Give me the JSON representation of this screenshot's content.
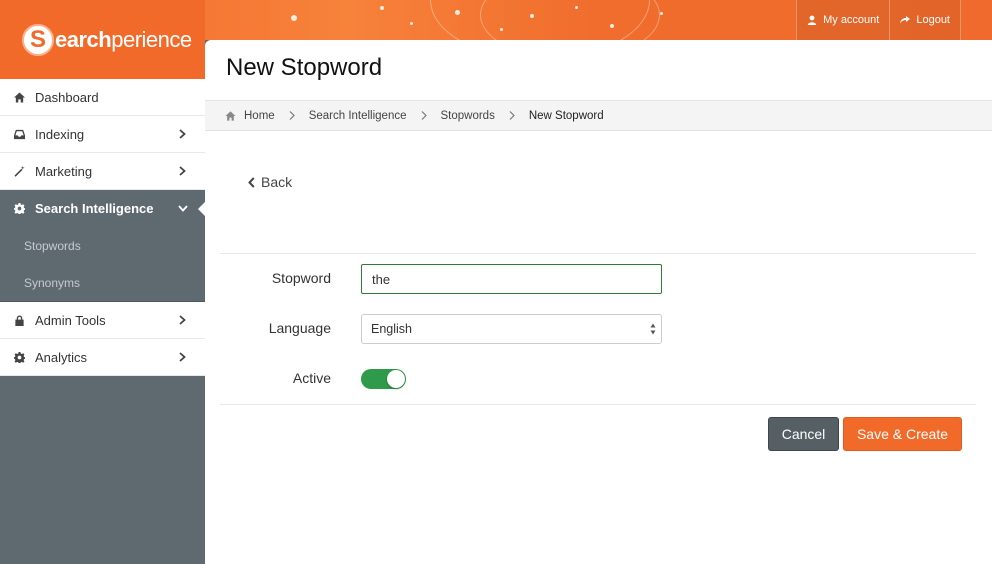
{
  "header": {
    "logo_prefix": "S",
    "logo_text_bold": "earch",
    "logo_text_rest": "perience",
    "links": [
      {
        "label": "My account",
        "icon": "user-icon"
      },
      {
        "label": "Logout",
        "icon": "logout-icon"
      }
    ]
  },
  "sidebar": {
    "items": [
      {
        "label": "Dashboard",
        "icon": "home-icon",
        "has_children": false
      },
      {
        "label": "Indexing",
        "icon": "inbox-icon",
        "has_children": true
      },
      {
        "label": "Marketing",
        "icon": "wand-icon",
        "has_children": true
      },
      {
        "label": "Search Intelligence",
        "icon": "gear-icon",
        "has_children": true,
        "active": true
      },
      {
        "label": "Admin Tools",
        "icon": "lock-icon",
        "has_children": true
      },
      {
        "label": "Analytics",
        "icon": "gear-icon",
        "has_children": true
      }
    ],
    "sub_items": [
      {
        "label": "Stopwords"
      },
      {
        "label": "Synonyms"
      }
    ]
  },
  "page": {
    "title": "New Stopword",
    "breadcrumb": [
      "Home",
      "Search Intelligence",
      "Stopwords",
      "New Stopword"
    ],
    "back_label": "Back"
  },
  "form": {
    "stopword_label": "Stopword",
    "stopword_value": "the",
    "language_label": "Language",
    "language_value": "English",
    "active_label": "Active",
    "active_on": true,
    "cancel_label": "Cancel",
    "save_label": "Save & Create"
  },
  "colors": {
    "accent": "#f26a2a",
    "sidebar_dark": "#5f6a70",
    "toggle_on": "#2f9b4a",
    "input_focus_border": "#2e7d32"
  }
}
